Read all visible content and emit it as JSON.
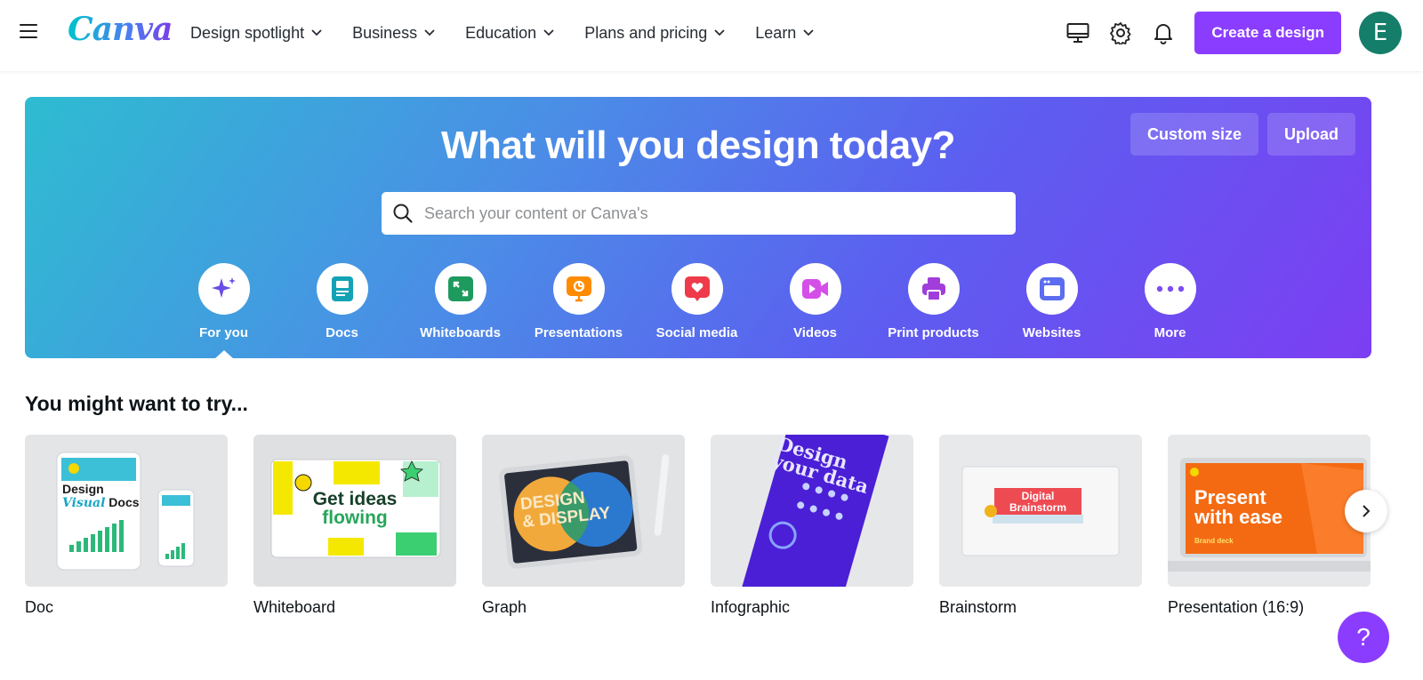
{
  "brand": {
    "logo_text": "Canva",
    "accent": "#8b3dff",
    "avatar_color": "#157e6a"
  },
  "nav": {
    "items": [
      {
        "label": "Design spotlight"
      },
      {
        "label": "Business"
      },
      {
        "label": "Education"
      },
      {
        "label": "Plans and pricing"
      },
      {
        "label": "Learn"
      }
    ],
    "create_label": "Create a design",
    "avatar_initial": "E",
    "icons": [
      "monitor-icon",
      "gear-icon",
      "bell-icon"
    ]
  },
  "hero": {
    "title": "What will you design today?",
    "custom_size_label": "Custom size",
    "upload_label": "Upload",
    "search_placeholder": "Search your content or Canva's",
    "categories": [
      {
        "label": "For you",
        "icon": "sparkle-icon",
        "selected": true
      },
      {
        "label": "Docs",
        "icon": "doc-icon"
      },
      {
        "label": "Whiteboards",
        "icon": "whiteboard-icon"
      },
      {
        "label": "Presentations",
        "icon": "presentation-icon"
      },
      {
        "label": "Social media",
        "icon": "heart-icon"
      },
      {
        "label": "Videos",
        "icon": "video-icon"
      },
      {
        "label": "Print products",
        "icon": "printer-icon"
      },
      {
        "label": "Websites",
        "icon": "website-icon"
      },
      {
        "label": "More",
        "icon": "more-icon"
      }
    ]
  },
  "suggestions": {
    "title": "You might want to try...",
    "cards": [
      {
        "label": "Doc",
        "thumb_text": [
          "Design",
          "Visual",
          "Docs"
        ]
      },
      {
        "label": "Whiteboard",
        "thumb_text": [
          "Get ideas",
          "flowing"
        ]
      },
      {
        "label": "Graph",
        "thumb_text": [
          "DESIGN",
          "& DISPLAY"
        ]
      },
      {
        "label": "Infographic",
        "thumb_text": [
          "Design",
          "your data"
        ]
      },
      {
        "label": "Brainstorm",
        "thumb_text": [
          "Digital",
          "Brainstorm"
        ]
      },
      {
        "label": "Presentation (16:9)",
        "thumb_text": [
          "Present",
          "with ease",
          "Brand deck"
        ]
      }
    ]
  },
  "help_label": "?"
}
